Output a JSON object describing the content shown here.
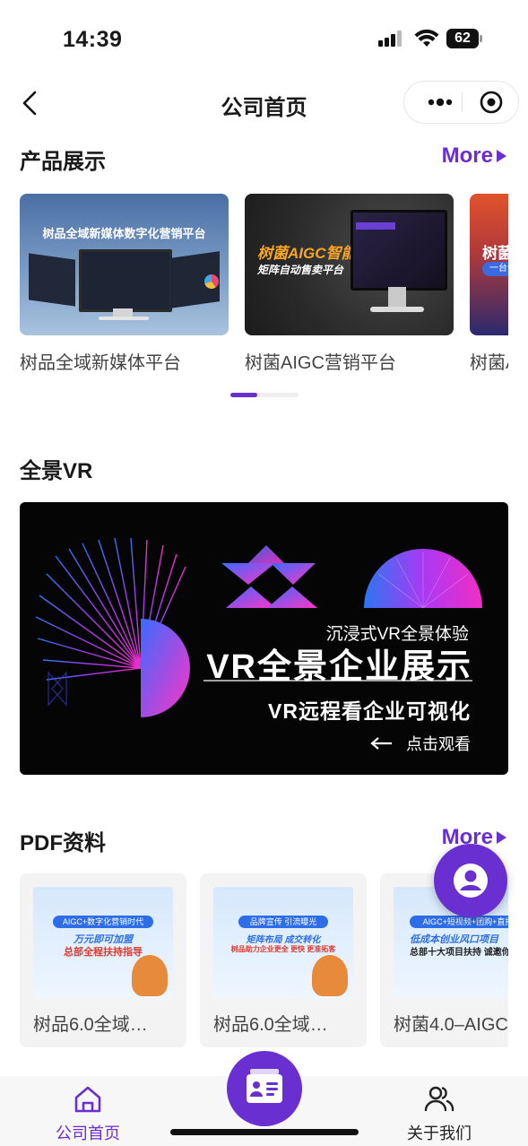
{
  "status_bar": {
    "time": "14:39",
    "battery": "62"
  },
  "nav": {
    "title": "公司首页"
  },
  "products": {
    "title": "产品展示",
    "more": "More",
    "items": [
      {
        "label": "树品全域新媒体平台",
        "image_text": "树品全域新媒体数字化营销平台"
      },
      {
        "label": "树菌AIGC营销平台",
        "image_text_1": "树菌AIGC智能",
        "image_text_2": "矩阵自动售卖平台"
      },
      {
        "label": "树菌AIGC",
        "image_text": "树菌",
        "image_sub": "一台设"
      }
    ]
  },
  "vr": {
    "title": "全景VR",
    "subtitle": "沉浸式VR全景体验",
    "headline": "VR全景企业展示",
    "caption": "VR远程看企业可视化",
    "cta": "点击观看"
  },
  "pdf": {
    "title": "PDF资料",
    "more": "More",
    "items": [
      {
        "label": "树品6.0全域…",
        "tag": "AIGC+数字化营销时代",
        "line1": "万元即可加盟",
        "line2": "总部全程扶持指导"
      },
      {
        "label": "树品6.0全域…",
        "tag": "品牌宣传 引流曝光",
        "line1": "矩阵布局 成交转化",
        "line2": "树品助力企业更全 更快 更准拓客"
      },
      {
        "label": "树菌4.0–AIGC",
        "tag": "AIGC+短视频+团购+直播",
        "line1": "低成本创业风口项目",
        "line2": "总部十大项目扶持 诚邀你的"
      }
    ]
  },
  "tabbar": {
    "home": "公司首页",
    "about": "关于我们"
  },
  "colors": {
    "accent": "#6a2fd1"
  }
}
